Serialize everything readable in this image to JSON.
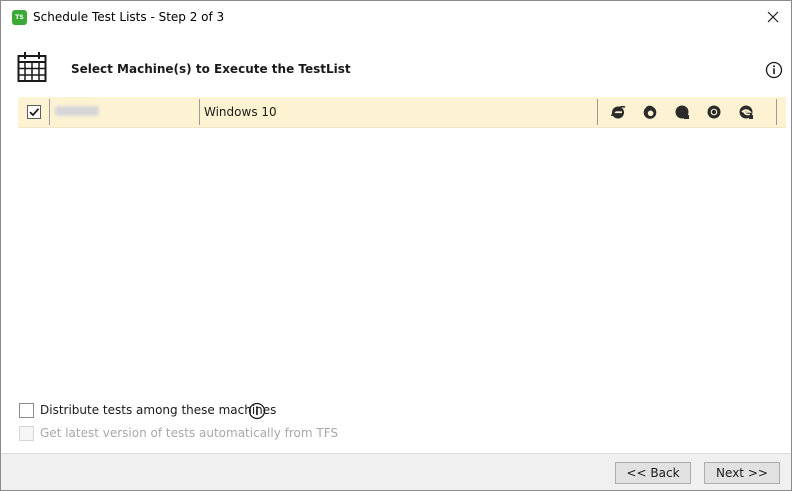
{
  "window": {
    "title": "Schedule Test Lists - Step 2 of 3",
    "app_icon_text": "TS"
  },
  "header": {
    "title": "Select Machine(s) to Execute the TestList"
  },
  "machines": [
    {
      "name": "",
      "os": "Windows 10",
      "checked": true,
      "browsers": [
        "internet-explorer-icon",
        "firefox-icon",
        "safari-icon",
        "chrome-icon",
        "edge-icon"
      ]
    }
  ],
  "options": {
    "distribute_label": "Distribute tests among these machines",
    "distribute_checked": false,
    "latest_label": "Get latest version of tests automatically from TFS",
    "latest_enabled": false
  },
  "footer": {
    "back_label": "<< Back",
    "next_label": "Next >>"
  },
  "colors": {
    "row_highlight": "#fdf3d3",
    "logo_green": "#3aa935",
    "footer_bg": "#f0f0f0"
  }
}
